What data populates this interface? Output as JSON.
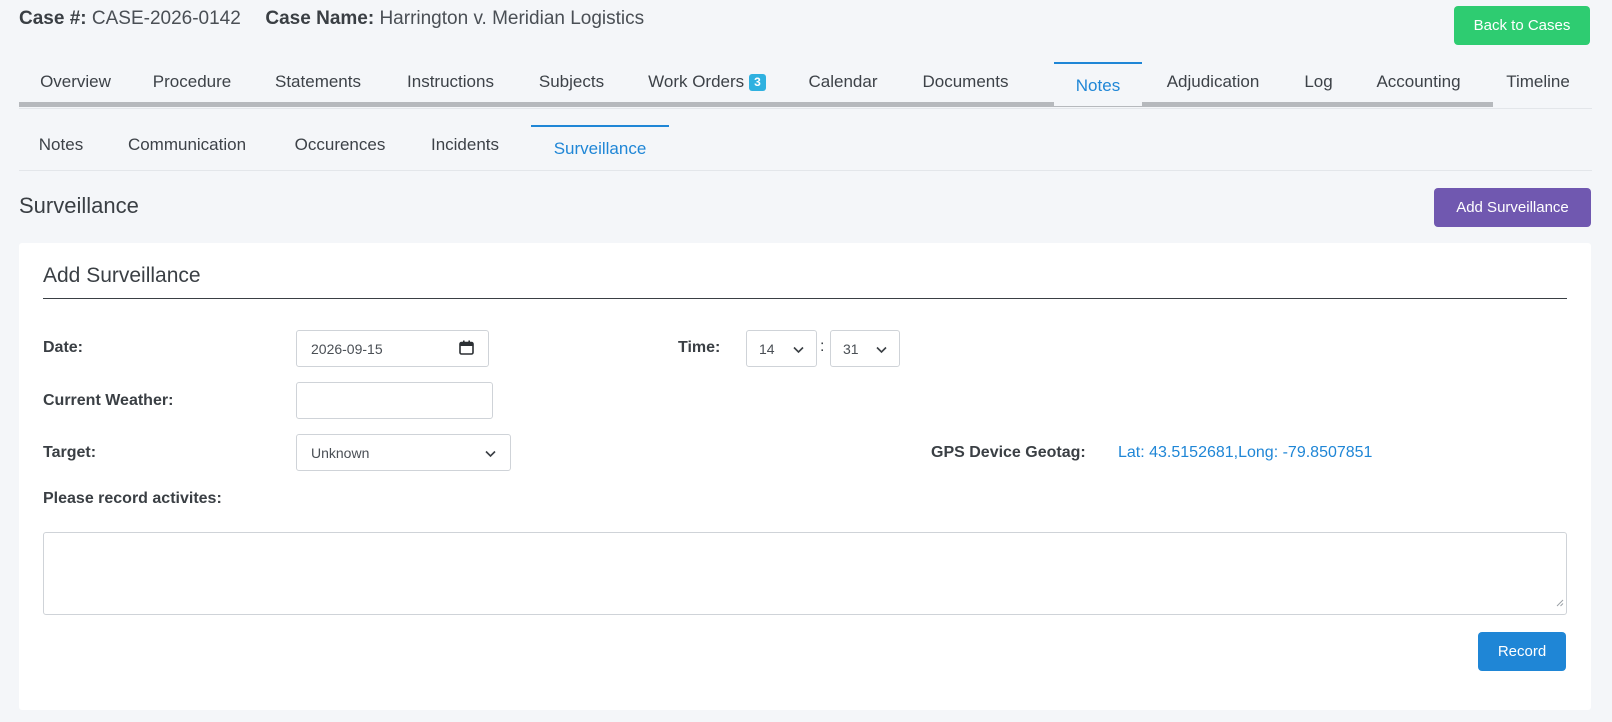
{
  "case": {
    "number_label": "Case #:",
    "number": "CASE-2026-0142",
    "name_label": "Case Name:",
    "name": "Harrington v. Meridian Logistics"
  },
  "back_button": "Back to Cases",
  "main_tabs": [
    {
      "label": "Overview"
    },
    {
      "label": "Procedure"
    },
    {
      "label": "Statements"
    },
    {
      "label": "Instructions"
    },
    {
      "label": "Subjects"
    },
    {
      "label": "Work Orders",
      "badge": "3"
    },
    {
      "label": "Calendar"
    },
    {
      "label": "Documents"
    },
    {
      "label": "Notes",
      "active": true
    },
    {
      "label": "Adjudication"
    },
    {
      "label": "Log"
    },
    {
      "label": "Accounting"
    },
    {
      "label": "Timeline"
    }
  ],
  "sub_tabs": [
    {
      "label": "Notes"
    },
    {
      "label": "Communication"
    },
    {
      "label": "Occurences"
    },
    {
      "label": "Incidents"
    },
    {
      "label": "Surveillance",
      "active": true
    }
  ],
  "section": {
    "title": "Surveillance",
    "add_button": "Add Surveillance"
  },
  "form": {
    "title": "Add Surveillance",
    "date_label": "Date:",
    "date_value": "2026-09-15",
    "time_label": "Time:",
    "time_hour": "14",
    "time_separator": ":",
    "time_minute": "31",
    "weather_label": "Current Weather:",
    "weather_value": "",
    "target_label": "Target:",
    "target_value": "Unknown",
    "gps_label": "GPS Device Geotag:",
    "gps_value": "Lat: 43.5152681,Long: -79.8507851",
    "activities_label": "Please record activites:",
    "activities_value": "",
    "record_button": "Record"
  },
  "colors": {
    "accent": "#1f86d6",
    "back_button": "#2ecc71",
    "add_button": "#7058b0",
    "badge": "#2fb1e0"
  },
  "icons": {
    "date_field": "calendar-icon",
    "select": "chevron-down-icon"
  }
}
